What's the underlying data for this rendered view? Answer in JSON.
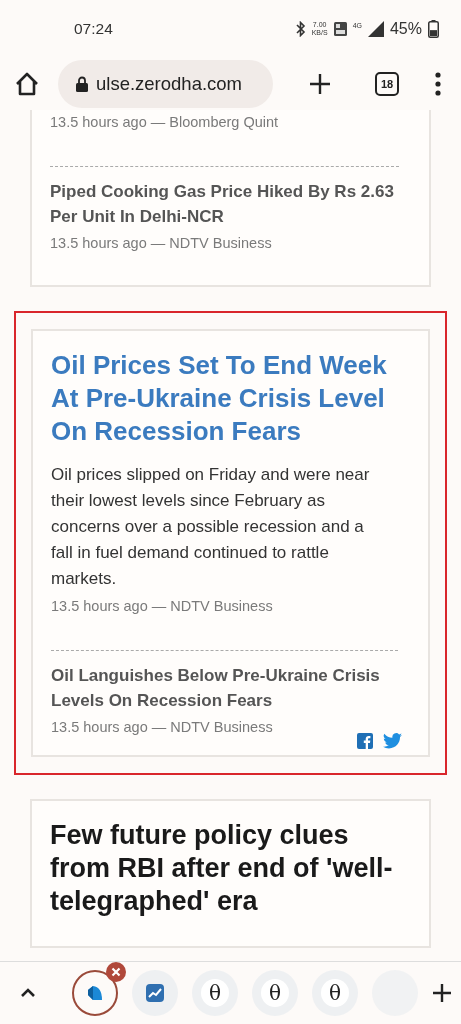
{
  "status_bar": {
    "time": "07:24",
    "speed_value": "7.00",
    "speed_unit": "KB/S",
    "network": "4G",
    "battery": "45%"
  },
  "address_bar": {
    "url": "ulse.zerodha.com",
    "tab_count": "18"
  },
  "cards": [
    {
      "kind": "plain",
      "highlighted": false,
      "meta": "13.5 hours ago — Bloomberg Quint",
      "related": [
        {
          "title": "Piped Cooking Gas Price Hiked By Rs 2.63 Per Unit In Delhi-NCR",
          "meta": "13.5 hours ago — NDTV Business"
        }
      ],
      "share": false
    },
    {
      "kind": "featured",
      "highlighted": true,
      "title": "Oil Prices Set To End Week At Pre-Ukraine Crisis Level On Recession Fears",
      "summary": "Oil prices slipped on Friday and were near their lowest levels since February as concerns over a possible recession and a fall in fuel demand continued to rattle markets.",
      "meta": "13.5 hours ago — NDTV Business",
      "related": [
        {
          "title": "Oil Languishes Below Pre-Ukraine Crisis Levels On Recession Fears",
          "meta": "13.5 hours ago — NDTV Business"
        }
      ],
      "share": true
    },
    {
      "kind": "plain",
      "highlighted": false,
      "title": "Few future policy clues from RBI after end of 'well-telegraphed' era",
      "share": false
    }
  ],
  "tab_strip": [
    {
      "kind": "kite",
      "selected": true
    },
    {
      "kind": "chart",
      "selected": false
    },
    {
      "kind": "letter",
      "glyph": "θ",
      "selected": false
    },
    {
      "kind": "letter",
      "glyph": "θ",
      "selected": false
    },
    {
      "kind": "letter",
      "glyph": "θ",
      "selected": false
    },
    {
      "kind": "faded",
      "selected": false
    }
  ]
}
